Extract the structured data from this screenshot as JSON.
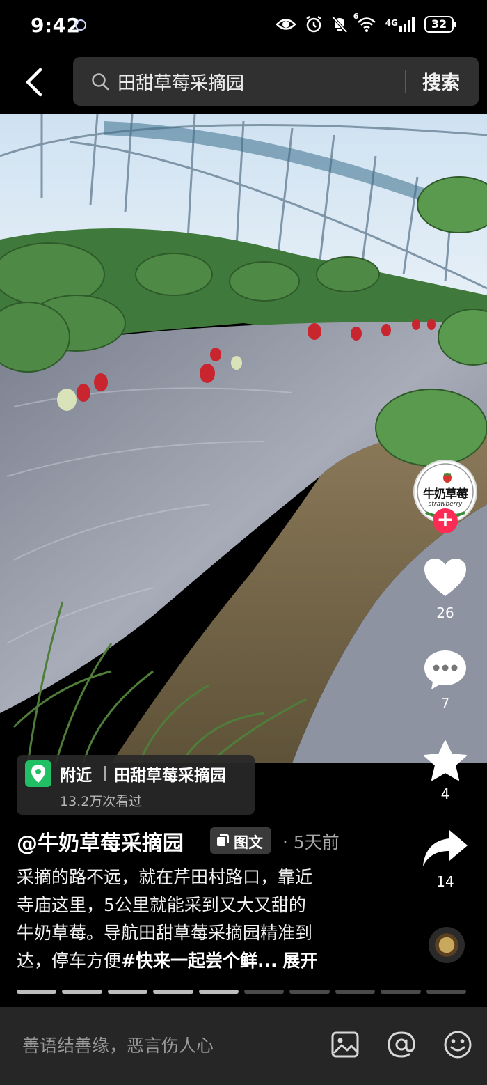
{
  "status_bar": {
    "time": "9:42",
    "network": "4G",
    "wifi_label": "6",
    "battery": "32",
    "icons": [
      "eye-icon",
      "alarm-icon",
      "mute-icon",
      "wifi-icon",
      "signal-icon",
      "battery-icon"
    ]
  },
  "search": {
    "query": "田甜草莓采摘园",
    "button_label": "搜索"
  },
  "photo": {
    "subject": "strawberry-greenhouse-photo"
  },
  "sidebar": {
    "avatar_name": "牛奶草莓",
    "avatar_sub": "strawberry",
    "likes": "26",
    "comments": "7",
    "favorites": "4",
    "shares": "14"
  },
  "location": {
    "nearby_label": "附近",
    "place_name": "田甜草莓采摘园",
    "views": "13.2万次看过"
  },
  "post": {
    "author": "@牛奶草莓采摘园",
    "type_label": "图文",
    "time": "· 5天前",
    "caption_lines": [
      "采摘的路不远，就在芹田村路口，靠近",
      "寺庙这里，5公里就能采到又大又甜的",
      "牛奶草莓。导航田甜草莓采摘园精准到"
    ],
    "caption_last_prefix": "达，停车方便",
    "hashtag": "#快来一起尝个鲜...",
    "expand_label": "展开"
  },
  "progress": {
    "total_segments": 10,
    "current_segment": 5
  },
  "comment_bar": {
    "placeholder": "善语结善缘，恶言伤人心"
  },
  "colors": {
    "accent_red": "#fe2c55",
    "location_green": "#22c064",
    "background": "#000000",
    "comment_bar_bg": "#262626"
  }
}
